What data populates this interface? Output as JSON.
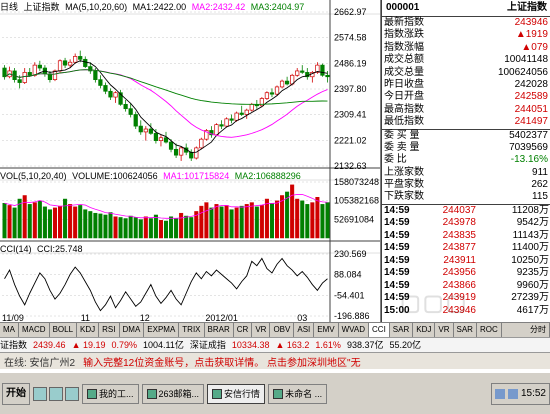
{
  "price_chart": {
    "period_label": "日线",
    "index_name": "上证指数",
    "ma_header": "MA(5,10,20,60)",
    "ma1": "MA1:2422.00",
    "ma2": "MA2:2432.42",
    "ma3": "MA3:2404.97",
    "y_ticks": [
      "2662.97",
      "2574.58",
      "2486.19",
      "2397.80",
      "2309.41",
      "2221.02",
      "2132.63"
    ],
    "y_range": [
      2132.63,
      2662.97
    ],
    "candles": [
      [
        2470,
        2480,
        2430,
        2440
      ],
      [
        2440,
        2475,
        2435,
        2460
      ],
      [
        2460,
        2470,
        2420,
        2430
      ],
      [
        2430,
        2445,
        2400,
        2420
      ],
      [
        2420,
        2470,
        2415,
        2455
      ],
      [
        2455,
        2470,
        2440,
        2445
      ],
      [
        2445,
        2490,
        2440,
        2480
      ],
      [
        2480,
        2495,
        2460,
        2470
      ],
      [
        2470,
        2480,
        2440,
        2450
      ],
      [
        2450,
        2460,
        2420,
        2430
      ],
      [
        2430,
        2465,
        2425,
        2460
      ],
      [
        2460,
        2500,
        2455,
        2495
      ],
      [
        2495,
        2505,
        2470,
        2480
      ],
      [
        2480,
        2500,
        2470,
        2490
      ],
      [
        2490,
        2520,
        2485,
        2510
      ],
      [
        2510,
        2530,
        2490,
        2500
      ],
      [
        2500,
        2510,
        2470,
        2475
      ],
      [
        2475,
        2490,
        2450,
        2460
      ],
      [
        2460,
        2470,
        2420,
        2430
      ],
      [
        2430,
        2445,
        2400,
        2410
      ],
      [
        2410,
        2420,
        2380,
        2390
      ],
      [
        2390,
        2400,
        2360,
        2370
      ],
      [
        2370,
        2390,
        2350,
        2385
      ],
      [
        2385,
        2395,
        2340,
        2345
      ],
      [
        2345,
        2360,
        2320,
        2330
      ],
      [
        2330,
        2350,
        2300,
        2310
      ],
      [
        2310,
        2320,
        2260,
        2270
      ],
      [
        2270,
        2290,
        2240,
        2250
      ],
      [
        2250,
        2270,
        2220,
        2260
      ],
      [
        2260,
        2280,
        2240,
        2245
      ],
      [
        2245,
        2260,
        2210,
        2220
      ],
      [
        2220,
        2240,
        2200,
        2230
      ],
      [
        2230,
        2250,
        2210,
        2215
      ],
      [
        2215,
        2225,
        2180,
        2190
      ],
      [
        2190,
        2210,
        2160,
        2170
      ],
      [
        2170,
        2200,
        2150,
        2195
      ],
      [
        2195,
        2210,
        2170,
        2180
      ],
      [
        2180,
        2190,
        2150,
        2160
      ],
      [
        2160,
        2200,
        2155,
        2195
      ],
      [
        2195,
        2230,
        2190,
        2225
      ],
      [
        2225,
        2260,
        2220,
        2255
      ],
      [
        2255,
        2270,
        2230,
        2240
      ],
      [
        2240,
        2280,
        2235,
        2275
      ],
      [
        2275,
        2290,
        2260,
        2270
      ],
      [
        2270,
        2300,
        2265,
        2295
      ],
      [
        2295,
        2310,
        2280,
        2290
      ],
      [
        2290,
        2320,
        2285,
        2315
      ],
      [
        2315,
        2340,
        2305,
        2310
      ],
      [
        2310,
        2330,
        2295,
        2325
      ],
      [
        2325,
        2350,
        2320,
        2345
      ],
      [
        2345,
        2360,
        2330,
        2340
      ],
      [
        2340,
        2370,
        2335,
        2365
      ],
      [
        2365,
        2390,
        2360,
        2385
      ],
      [
        2385,
        2400,
        2370,
        2380
      ],
      [
        2380,
        2410,
        2375,
        2405
      ],
      [
        2405,
        2430,
        2400,
        2425
      ],
      [
        2425,
        2440,
        2410,
        2415
      ],
      [
        2415,
        2450,
        2410,
        2445
      ],
      [
        2445,
        2470,
        2440,
        2460
      ],
      [
        2460,
        2480,
        2450,
        2455
      ],
      [
        2455,
        2470,
        2430,
        2440
      ],
      [
        2440,
        2460,
        2420,
        2455
      ],
      [
        2455,
        2490,
        2450,
        2480
      ],
      [
        2480,
        2485,
        2440,
        2445
      ],
      [
        2445,
        2460,
        2420,
        2440
      ]
    ]
  },
  "volume_chart": {
    "header": "VOL(5,10,20,40)",
    "volume": "VOLUME:100624056",
    "ma1": "MA1:101715824",
    "ma2": "MA2:106888296",
    "y_ticks": [
      "158073248",
      "105382168",
      "52691084"
    ],
    "y_max": 158073248,
    "values": [
      98,
      92,
      85,
      110,
      120,
      95,
      100,
      105,
      88,
      80,
      85,
      90,
      110,
      95,
      88,
      92,
      80,
      75,
      70,
      68,
      65,
      72,
      60,
      58,
      55,
      62,
      58,
      52,
      60,
      55,
      65,
      50,
      48,
      60,
      55,
      70,
      62,
      58,
      75,
      90,
      100,
      85,
      95,
      88,
      92,
      80,
      85,
      90,
      95,
      100,
      88,
      92,
      110,
      98,
      105,
      120,
      130,
      150,
      110,
      105,
      95,
      100,
      115,
      95,
      100
    ]
  },
  "cci_chart": {
    "header": "CCI(14)",
    "value": "CCI:25.748",
    "y_ticks": [
      "230.569",
      "88.084",
      "-54.401",
      "-196.886"
    ],
    "y_range": [
      -196.886,
      230.569
    ],
    "values": [
      60,
      120,
      20,
      -60,
      -120,
      -40,
      30,
      100,
      60,
      -20,
      -80,
      -40,
      20,
      90,
      140,
      100,
      40,
      -20,
      -100,
      -160,
      -120,
      -60,
      -140,
      -90,
      -30,
      -80,
      -130,
      -100,
      -40,
      20,
      -60,
      -110,
      -70,
      -20,
      -80,
      -120,
      -40,
      40,
      100,
      60,
      110,
      80,
      120,
      90,
      60,
      30,
      -10,
      40,
      80,
      180,
      150,
      200,
      130,
      100,
      160,
      200,
      150,
      120,
      80,
      110,
      70,
      20,
      -20,
      30,
      60
    ]
  },
  "x_axis_labels": [
    "11/09",
    "11",
    "12",
    "2012/01",
    "03"
  ],
  "quote": {
    "code": "000001",
    "name": "上证指数",
    "rows": [
      {
        "label": "最新指数",
        "value": "243946",
        "color": "red"
      },
      {
        "label": "指数涨跌",
        "value": "▲1919",
        "color": "red"
      },
      {
        "label": "指数涨幅",
        "value": "▲079",
        "color": "red"
      },
      {
        "label": "成交总额",
        "value": "10041148",
        "color": "black"
      },
      {
        "label": "成交总量",
        "value": "100624056",
        "color": "black"
      },
      {
        "label": "昨日收盘",
        "value": "242028",
        "color": "black"
      },
      {
        "label": "今日开盘",
        "value": "242589",
        "color": "red"
      },
      {
        "label": "最高指数",
        "value": "244051",
        "color": "red"
      },
      {
        "label": "最低指数",
        "value": "241497",
        "color": "red"
      }
    ],
    "rows2": [
      {
        "label": "委 买 量",
        "value": "5402377",
        "color": "black"
      },
      {
        "label": "委 卖 量",
        "value": "7039569",
        "color": "black"
      },
      {
        "label": "委 比",
        "value": "-13.16%",
        "color": "green"
      },
      {
        "label": "上涨家数",
        "value": "911",
        "color": "black"
      },
      {
        "label": "平盘家数",
        "value": "262",
        "color": "black"
      },
      {
        "label": "下跌家数",
        "value": "115",
        "color": "black"
      }
    ],
    "ticks": [
      {
        "time": "14:59",
        "price": "244037",
        "vol": "11208万"
      },
      {
        "time": "14:59",
        "price": "243978",
        "vol": "9542万"
      },
      {
        "time": "14:59",
        "price": "243835",
        "vol": "11143万"
      },
      {
        "time": "14:59",
        "price": "243877",
        "vol": "11400万"
      },
      {
        "time": "14:59",
        "price": "243911",
        "vol": "10250万"
      },
      {
        "time": "14:59",
        "price": "243956",
        "vol": "9235万"
      },
      {
        "time": "14:59",
        "price": "243866",
        "vol": "9960万"
      },
      {
        "time": "14:59",
        "price": "243919",
        "vol": "27239万"
      },
      {
        "time": "15:00",
        "price": "243946",
        "vol": "4617万"
      }
    ]
  },
  "tabs": [
    "MA",
    "MACD",
    "BOLL",
    "KDJ",
    "RSI",
    "DMA",
    "EXPMA",
    "TRIX",
    "BRAR",
    "CR",
    "VR",
    "OBV",
    "ASI",
    "EMV",
    "WVAD",
    "CCI",
    "SAR",
    "KDJ",
    "VR",
    "SAR",
    "ROC"
  ],
  "tabs_active_index": 15,
  "tab_right": "分时",
  "ticker": {
    "index": "证指数",
    "price": "2439.46",
    "change": "▲ 19.19",
    "pct": "0.79%",
    "amount": "1004.11亿",
    "label2": "深证成指",
    "price2": "10334.38",
    "change2": "▲ 163.2",
    "pct2": "1.61%",
    "amount2": "938.37亿",
    "extra": "55.20亿"
  },
  "msgbar": {
    "status": "在线: 安信广州2",
    "msg": "输入完整12位资金账号，点击获取详情。 点击参加深圳地区\"无"
  },
  "taskbar": {
    "start": "开始",
    "buttons": [
      "我的工...",
      "263邮箱...",
      "安信行情",
      "未命名 ..."
    ],
    "active_index": 2,
    "clock": "15:52"
  },
  "colors": {
    "up": "#d00000",
    "down": "#008000",
    "ma1": "#000000",
    "ma2": "#ff00ff",
    "ma3": "#008000"
  }
}
